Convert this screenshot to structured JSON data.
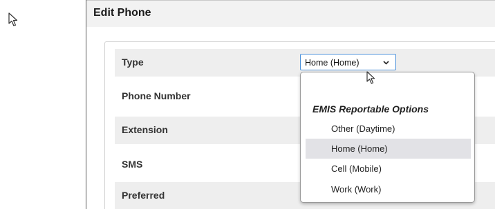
{
  "dialog": {
    "title": "Edit Phone"
  },
  "form": {
    "rows": [
      {
        "label": "Type"
      },
      {
        "label": "Phone Number"
      },
      {
        "label": "Extension"
      },
      {
        "label": "SMS"
      },
      {
        "label": "Preferred"
      }
    ],
    "type_select": {
      "value": "Home (Home)",
      "icon": "chevron-down-icon"
    }
  },
  "dropdown": {
    "group_label": "EMIS Reportable Options",
    "options": [
      {
        "label": "Other (Daytime)",
        "highlighted": false
      },
      {
        "label": "Home (Home)",
        "highlighted": true
      },
      {
        "label": "Cell (Mobile)",
        "highlighted": false
      },
      {
        "label": "Work (Work)",
        "highlighted": false
      }
    ],
    "highlight_color": "#e2e2e6"
  },
  "icons": {
    "cursor": "mouse-pointer-icon"
  }
}
